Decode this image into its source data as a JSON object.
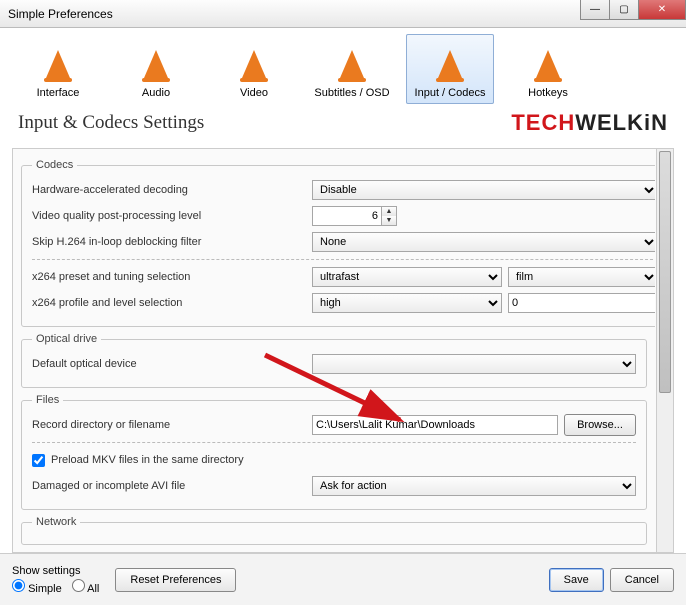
{
  "window": {
    "title": "Simple Preferences"
  },
  "tabs": [
    {
      "label": "Interface"
    },
    {
      "label": "Audio"
    },
    {
      "label": "Video"
    },
    {
      "label": "Subtitles / OSD"
    },
    {
      "label": "Input / Codecs"
    },
    {
      "label": "Hotkeys"
    }
  ],
  "heading": "Input & Codecs Settings",
  "brand": {
    "red": "TECH",
    "black": "WELKiN"
  },
  "codecs": {
    "legend": "Codecs",
    "hwDecodeLabel": "Hardware-accelerated decoding",
    "hwDecodeValue": "Disable",
    "vqLabel": "Video quality post-processing level",
    "vqValue": "6",
    "skipLabel": "Skip H.264 in-loop deblocking filter",
    "skipValue": "None",
    "presetLabel": "x264 preset and tuning selection",
    "presetValue": "ultrafast",
    "tuneValue": "film",
    "profileLabel": "x264 profile and level selection",
    "profileValue": "high",
    "levelValue": "0"
  },
  "optical": {
    "legend": "Optical drive",
    "deviceLabel": "Default optical device",
    "deviceValue": ""
  },
  "files": {
    "legend": "Files",
    "recordLabel": "Record directory or filename",
    "recordValue": "C:\\Users\\Lalit Kumar\\Downloads",
    "browse": "Browse...",
    "preloadLabel": "Preload MKV files in the same directory",
    "preloadChecked": true,
    "aviLabel": "Damaged or incomplete AVI file",
    "aviValue": "Ask for action"
  },
  "network": {
    "legend": "Network"
  },
  "footer": {
    "show": "Show settings",
    "simple": "Simple",
    "all": "All",
    "reset": "Reset Preferences",
    "save": "Save",
    "cancel": "Cancel"
  }
}
